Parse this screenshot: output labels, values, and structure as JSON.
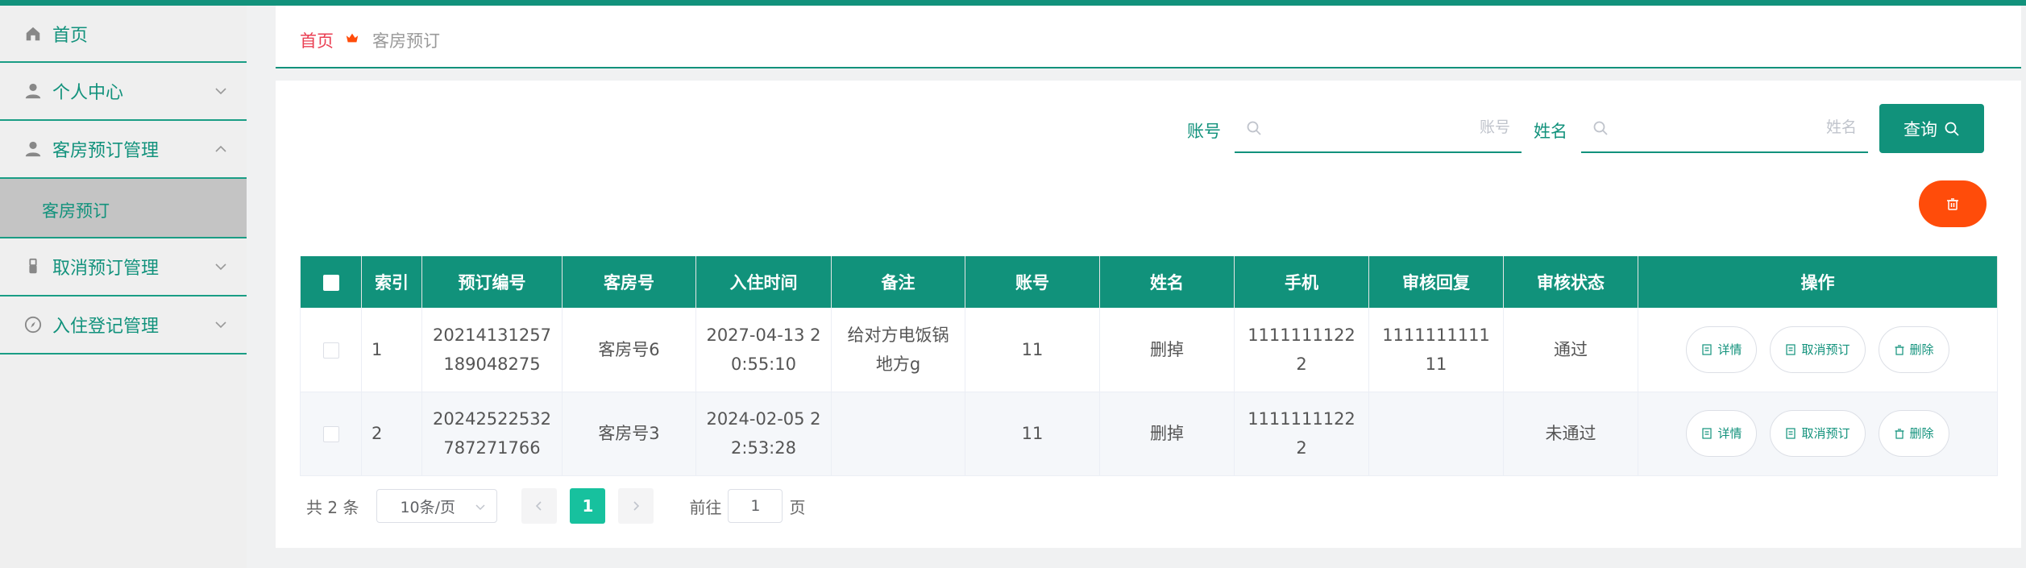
{
  "colors": {
    "brand": "#12927c",
    "danger": "#ff4c0a",
    "crumb_home": "#ea3f53",
    "page_active": "#17c19e"
  },
  "sidebar": {
    "items": [
      {
        "label": "首页",
        "icon": "home-icon"
      },
      {
        "label": "个人中心",
        "icon": "user-icon"
      },
      {
        "label": "客房预订管理",
        "icon": "user-icon",
        "expanded": true,
        "children": [
          {
            "label": "客房预订"
          }
        ]
      },
      {
        "label": "取消预订管理",
        "icon": "usb-icon"
      },
      {
        "label": "入住登记管理",
        "icon": "compass-icon"
      }
    ]
  },
  "breadcrumb": {
    "home": "首页",
    "current": "客房预订"
  },
  "search": {
    "account_label": "账号",
    "account_placeholder": "账号",
    "account_value": "",
    "name_label": "姓名",
    "name_placeholder": "姓名",
    "name_value": "",
    "query_label": "查询"
  },
  "table": {
    "headers": [
      "",
      "索引",
      "预订编号",
      "客房号",
      "入住时间",
      "备注",
      "账号",
      "姓名",
      "手机",
      "审核回复",
      "审核状态",
      "操作"
    ],
    "rows": [
      {
        "index": "1",
        "booking_no": "20214131257189048275",
        "room_no": "客房号6",
        "checkin_time": "2027-04-13 20:55:10",
        "remark": "给对方电饭锅地方g",
        "account": "11",
        "name": "删掉",
        "phone": "11111111222",
        "reply": "111111111111",
        "status": "通过"
      },
      {
        "index": "2",
        "booking_no": "20242522532787271766",
        "room_no": "客房号3",
        "checkin_time": "2024-02-05 22:53:28",
        "remark": "",
        "account": "11",
        "name": "删掉",
        "phone": "11111111222",
        "reply": "",
        "status": "未通过"
      }
    ],
    "actions": {
      "detail": "详情",
      "cancel": "取消预订",
      "delete": "删除"
    }
  },
  "pagination": {
    "total": "共 2 条",
    "page_size": "10条/页",
    "current_page": "1",
    "goto_prefix": "前往",
    "goto_value": "1",
    "goto_suffix": "页"
  }
}
